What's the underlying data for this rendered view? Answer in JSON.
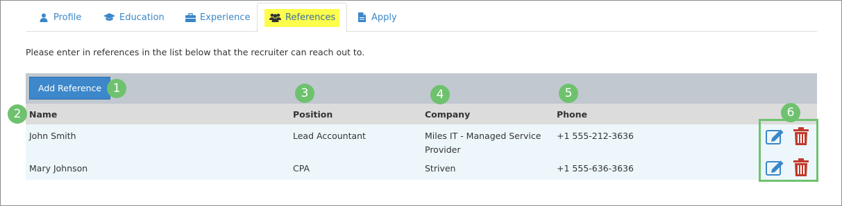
{
  "tabs": [
    {
      "label": "Profile",
      "icon": "user-icon"
    },
    {
      "label": "Education",
      "icon": "graduation-cap-icon"
    },
    {
      "label": "Experience",
      "icon": "briefcase-icon"
    },
    {
      "label": "References",
      "icon": "users-icon",
      "active": true
    },
    {
      "label": "Apply",
      "icon": "document-icon"
    }
  ],
  "intro": "Please enter in references in the list below that the recruiter can reach out to.",
  "toolbar": {
    "add_label": "Add Reference"
  },
  "table": {
    "headers": {
      "name": "Name",
      "position": "Position",
      "company": "Company",
      "phone": "Phone"
    },
    "rows": [
      {
        "name": "John Smith",
        "position": "Lead Accountant",
        "company": "Miles IT - Managed Service Provider",
        "phone": "+1 555-212-3636"
      },
      {
        "name": "Mary Johnson",
        "position": "CPA",
        "company": "Striven",
        "phone": "+1 555-636-3636"
      }
    ]
  },
  "callouts": [
    "1",
    "2",
    "3",
    "4",
    "5",
    "6"
  ],
  "colors": {
    "link": "#3a87c8",
    "highlight": "#fdfd4c",
    "button": "#3d87cb",
    "callout": "#6ec26e",
    "delete": "#c0392b",
    "edit": "#3a87c8"
  }
}
